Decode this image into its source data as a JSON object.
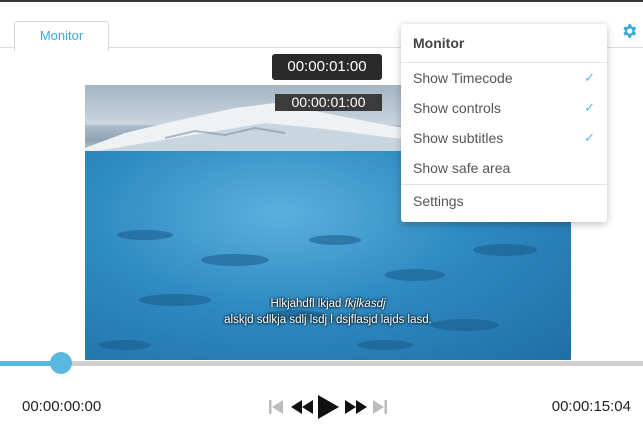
{
  "tabs": [
    {
      "label": "Monitor"
    }
  ],
  "overlay": {
    "timecode": "00:00:01:00",
    "burnin_timecode": "00:00:01:00"
  },
  "subtitles": {
    "line1_plain": "Hlkjahdfl lkjad ",
    "line1_italic": "fkjlkasdj",
    "line2": "alskjd sdlkja sdlj lsdj l dsjflasjd lajds lasd."
  },
  "monitor_menu": {
    "title": "Monitor",
    "items": [
      {
        "label": "Show Timecode",
        "checked": true
      },
      {
        "label": "Show controls",
        "checked": true
      },
      {
        "label": "Show subtitles",
        "checked": true
      },
      {
        "label": "Show safe area",
        "checked": false
      }
    ],
    "settings_label": "Settings",
    "check_glyph": "✓"
  },
  "player": {
    "current_time": "00:00:00:00",
    "duration": "00:00:15:04",
    "progress_fraction": 0.08
  },
  "icons": {
    "settings": "gear-icon",
    "skip_start": "skip-to-start-icon",
    "rewind": "rewind-icon",
    "play": "play-icon",
    "fast_forward": "fast-forward-icon",
    "skip_end": "skip-to-end-icon"
  },
  "colors": {
    "accent": "#59b7e0",
    "tab_text": "#3aa9dc",
    "track": "#cfcfcf",
    "disabled_control": "#bdbdbd"
  }
}
